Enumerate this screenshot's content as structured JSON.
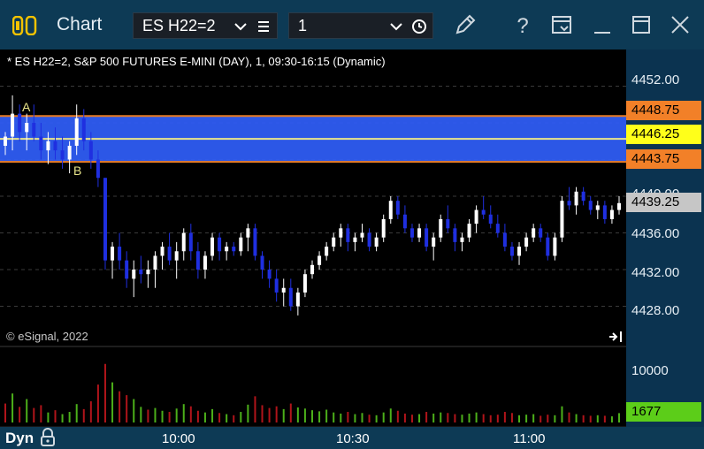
{
  "titlebar": {
    "title": "Chart",
    "symbol": "ES H22=2",
    "interval": "1",
    "icons": [
      "chart-logo-icon",
      "chevron-down-icon",
      "hamburger-menu-icon",
      "clock-icon",
      "pencil-icon",
      "help-icon",
      "window-layout-icon",
      "minimize-icon",
      "maximize-icon",
      "close-icon"
    ]
  },
  "chart": {
    "header": "* ES H22=2, S&P 500 FUTURES E-MINI (DAY), 1, 09:30-16:15 (Dynamic)",
    "watermark": "© eSignal, 2022",
    "price_axis_labels": [
      "4452.00",
      "4440.00",
      "4436.00",
      "4432.00",
      "4428.00"
    ],
    "price_tags": {
      "upper": "4448.75",
      "mid": "4446.25",
      "lower": "4443.75",
      "last": "4439.25"
    },
    "volume_axis_label": "10000",
    "volume_tag": "1677",
    "annotations": {
      "a": "A",
      "b": "B"
    },
    "bottom": {
      "mode": "Dyn"
    },
    "time_labels": [
      "10:00",
      "10:30",
      "11:00"
    ],
    "colors": {
      "band": "#2e5cf2",
      "band_line_outer": "#e87b22",
      "band_line_mid": "#e8e48a",
      "up": "#ffffff",
      "down": "#1f2fe0",
      "tag_orange": "#f28028",
      "tag_yellow": "#ffff1a",
      "tag_gray": "#c6c6c6",
      "tag_green": "#5ccd19",
      "vol_up": "#4caf1a",
      "vol_down": "#b0141a"
    }
  },
  "chart_data": {
    "type": "candlestick",
    "y_range": [
      4424,
      4456
    ],
    "band": {
      "low": 4443.75,
      "high": 4448.75,
      "mid": 4446.25
    },
    "candles": [
      [
        4445.5,
        4447,
        4444.5,
        4446.5
      ],
      [
        4446.5,
        4451,
        4445,
        4449
      ],
      [
        4449,
        4450,
        4446,
        4447
      ],
      [
        4447,
        4449,
        4445,
        4448
      ],
      [
        4448,
        4450,
        4446,
        4446.5
      ],
      [
        4446.5,
        4448,
        4444,
        4445
      ],
      [
        4445,
        4447,
        4443.5,
        4446
      ],
      [
        4446,
        4447.5,
        4444,
        4445
      ],
      [
        4445,
        4446.5,
        4443,
        4444
      ],
      [
        4444,
        4446,
        4442.5,
        4445.5
      ],
      [
        4445.5,
        4450,
        4444.5,
        4448.5
      ],
      [
        4448.5,
        4449.5,
        4445,
        4446
      ],
      [
        4446,
        4447,
        4443,
        4444
      ],
      [
        4444,
        4445,
        4441,
        4442
      ],
      [
        4442,
        4442,
        4432,
        4433
      ],
      [
        4433,
        4435,
        4431,
        4434.5
      ],
      [
        4434.5,
        4436,
        4432,
        4433
      ],
      [
        4433,
        4434,
        4430,
        4431
      ],
      [
        4431,
        4433,
        4429,
        4432
      ],
      [
        4432,
        4433.5,
        4430.5,
        4431.5
      ],
      [
        4431.5,
        4433,
        4430,
        4432
      ],
      [
        4432,
        4434,
        4430,
        4433.5
      ],
      [
        4433.5,
        4435,
        4432,
        4434.5
      ],
      [
        4434.5,
        4436,
        4432.5,
        4433
      ],
      [
        4433,
        4435,
        4431,
        4434
      ],
      [
        4434,
        4436.5,
        4433,
        4436
      ],
      [
        4436,
        4437,
        4433,
        4434
      ],
      [
        4434,
        4435,
        4431,
        4432
      ],
      [
        4432,
        4434,
        4431,
        4433.5
      ],
      [
        4433.5,
        4436,
        4433,
        4435.5
      ],
      [
        4435.5,
        4436,
        4433,
        4434
      ],
      [
        4434,
        4435,
        4433,
        4434.5
      ],
      [
        4434.5,
        4435,
        4433.5,
        4434
      ],
      [
        4434,
        4436,
        4433.5,
        4435.5
      ],
      [
        4435.5,
        4437,
        4434,
        4436.5
      ],
      [
        4436.5,
        4437,
        4433,
        4433.5
      ],
      [
        4433.5,
        4434,
        4431,
        4432
      ],
      [
        4432,
        4433,
        4430,
        4431
      ],
      [
        4431,
        4432,
        4428.5,
        4429.5
      ],
      [
        4429.5,
        4431,
        4428,
        4430
      ],
      [
        4430,
        4431,
        4427.5,
        4428
      ],
      [
        4428,
        4430,
        4427,
        4429.5
      ],
      [
        4429.5,
        4432,
        4429,
        4431.5
      ],
      [
        4431.5,
        4433,
        4431,
        4432.5
      ],
      [
        4432.5,
        4434,
        4432,
        4433.5
      ],
      [
        4433.5,
        4435,
        4433,
        4434.5
      ],
      [
        4434.5,
        4436,
        4434,
        4435.5
      ],
      [
        4435.5,
        4437,
        4434.5,
        4436.5
      ],
      [
        4436.5,
        4437,
        4434,
        4435
      ],
      [
        4435,
        4436,
        4434,
        4435.5
      ],
      [
        4435.5,
        4437,
        4435,
        4436
      ],
      [
        4436,
        4436.5,
        4434,
        4434.5
      ],
      [
        4434.5,
        4436,
        4434,
        4435.5
      ],
      [
        4435.5,
        4438,
        4435,
        4437.5
      ],
      [
        4437.5,
        4440,
        4437,
        4439.5
      ],
      [
        4439.5,
        4440,
        4437.5,
        4438
      ],
      [
        4438,
        4439,
        4436,
        4436.5
      ],
      [
        4436.5,
        4437,
        4435,
        4435.5
      ],
      [
        4435.5,
        4437,
        4435,
        4436.5
      ],
      [
        4436.5,
        4437,
        4434,
        4434.5
      ],
      [
        4434.5,
        4436,
        4433,
        4435.5
      ],
      [
        4435.5,
        4438,
        4435,
        4437.5
      ],
      [
        4437.5,
        4439,
        4436,
        4436.5
      ],
      [
        4436.5,
        4437,
        4434,
        4435
      ],
      [
        4435,
        4436,
        4434,
        4435.5
      ],
      [
        4435.5,
        4437.5,
        4435,
        4437
      ],
      [
        4437,
        4439,
        4436,
        4438.5
      ],
      [
        4438.5,
        4440,
        4437.5,
        4438
      ],
      [
        4438,
        4439,
        4436.5,
        4437
      ],
      [
        4437,
        4438,
        4435.5,
        4436
      ],
      [
        4436,
        4437,
        4434,
        4434.5
      ],
      [
        4434.5,
        4435,
        4433,
        4433.5
      ],
      [
        4433.5,
        4435,
        4432.5,
        4434.5
      ],
      [
        4434.5,
        4436,
        4434,
        4435.5
      ],
      [
        4435.5,
        4437,
        4435,
        4436.5
      ],
      [
        4436.5,
        4437,
        4435,
        4435.5
      ],
      [
        4435.5,
        4436,
        4433,
        4433.5
      ],
      [
        4433.5,
        4436,
        4433,
        4435.5
      ],
      [
        4435.5,
        4440,
        4435,
        4439.5
      ],
      [
        4439.5,
        4441,
        4438.5,
        4439
      ],
      [
        4439,
        4441,
        4438,
        4440.5
      ],
      [
        4440.5,
        4441,
        4439,
        4439.5
      ],
      [
        4439.5,
        4440,
        4438,
        4438.5
      ],
      [
        4438.5,
        4439.5,
        4437.5,
        4439
      ],
      [
        4439,
        4439.5,
        4437,
        4437.5
      ],
      [
        4437.5,
        4439,
        4437,
        4438.5
      ],
      [
        4438.5,
        4440,
        4438,
        4439.25
      ]
    ],
    "volumes": [
      [
        3400,
        0
      ],
      [
        5200,
        1
      ],
      [
        2800,
        0
      ],
      [
        4200,
        1
      ],
      [
        2600,
        0
      ],
      [
        3100,
        0
      ],
      [
        1800,
        1
      ],
      [
        2200,
        0
      ],
      [
        1500,
        1
      ],
      [
        1900,
        1
      ],
      [
        3300,
        1
      ],
      [
        2400,
        0
      ],
      [
        3800,
        0
      ],
      [
        6800,
        0
      ],
      [
        10500,
        0
      ],
      [
        7200,
        1
      ],
      [
        5600,
        0
      ],
      [
        4900,
        0
      ],
      [
        4200,
        1
      ],
      [
        2800,
        1
      ],
      [
        2300,
        0
      ],
      [
        2600,
        1
      ],
      [
        2100,
        1
      ],
      [
        1900,
        0
      ],
      [
        2500,
        1
      ],
      [
        3300,
        1
      ],
      [
        2900,
        0
      ],
      [
        2100,
        0
      ],
      [
        1800,
        1
      ],
      [
        2400,
        1
      ],
      [
        1700,
        0
      ],
      [
        1500,
        1
      ],
      [
        1300,
        0
      ],
      [
        1900,
        1
      ],
      [
        3200,
        1
      ],
      [
        4700,
        0
      ],
      [
        3100,
        0
      ],
      [
        2600,
        0
      ],
      [
        2900,
        0
      ],
      [
        2400,
        1
      ],
      [
        3400,
        0
      ],
      [
        2700,
        1
      ],
      [
        2500,
        1
      ],
      [
        2200,
        1
      ],
      [
        2000,
        1
      ],
      [
        2300,
        1
      ],
      [
        1800,
        1
      ],
      [
        1600,
        1
      ],
      [
        1900,
        0
      ],
      [
        1500,
        1
      ],
      [
        1700,
        1
      ],
      [
        1400,
        0
      ],
      [
        1300,
        1
      ],
      [
        1800,
        1
      ],
      [
        2500,
        1
      ],
      [
        2100,
        0
      ],
      [
        1600,
        0
      ],
      [
        1400,
        0
      ],
      [
        1500,
        1
      ],
      [
        1900,
        0
      ],
      [
        1600,
        1
      ],
      [
        1800,
        1
      ],
      [
        1700,
        0
      ],
      [
        1500,
        0
      ],
      [
        1400,
        1
      ],
      [
        1600,
        1
      ],
      [
        1800,
        1
      ],
      [
        1500,
        0
      ],
      [
        1300,
        0
      ],
      [
        1400,
        0
      ],
      [
        1900,
        0
      ],
      [
        1700,
        0
      ],
      [
        1300,
        1
      ],
      [
        1400,
        1
      ],
      [
        1500,
        1
      ],
      [
        1200,
        0
      ],
      [
        1400,
        0
      ],
      [
        1300,
        1
      ],
      [
        2900,
        1
      ],
      [
        1800,
        0
      ],
      [
        1500,
        1
      ],
      [
        1300,
        0
      ],
      [
        1200,
        0
      ],
      [
        1300,
        1
      ],
      [
        1200,
        0
      ],
      [
        1100,
        1
      ],
      [
        1677,
        1
      ]
    ],
    "volume_range": [
      0,
      13000
    ]
  }
}
